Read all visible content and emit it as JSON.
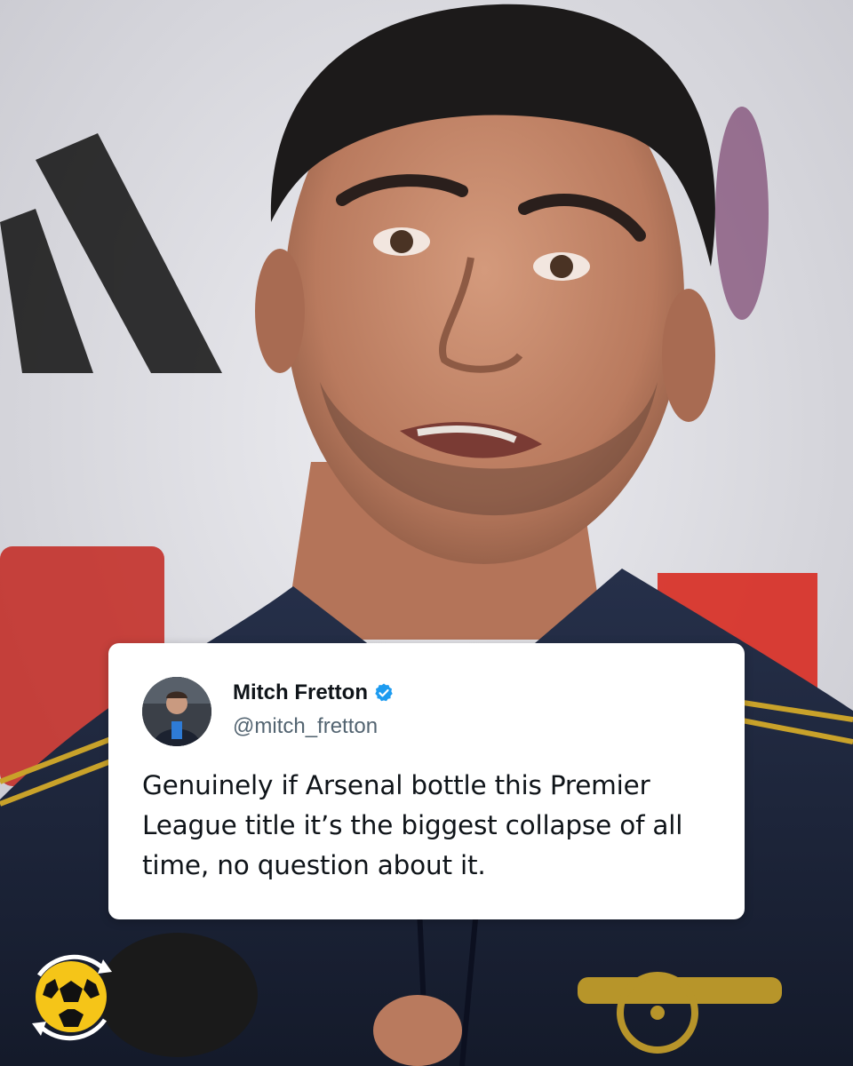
{
  "tweet": {
    "author_name": "Mitch Fretton",
    "author_handle": "@mitch_fretton",
    "verified_icon": "verified-badge-icon",
    "text": "Genuinely if Arsenal bottle this Premier League title it’s the biggest collapse of all time, no question about it."
  },
  "background": {
    "subject": "press-conference-photo"
  },
  "brand": {
    "logo_icon": "football-cycle-logo-icon",
    "accent_color": "#f5c518"
  },
  "colors": {
    "card": "#ffffff",
    "name": "#0f1419",
    "handle": "#536471",
    "verified": "#1d9bf0"
  }
}
